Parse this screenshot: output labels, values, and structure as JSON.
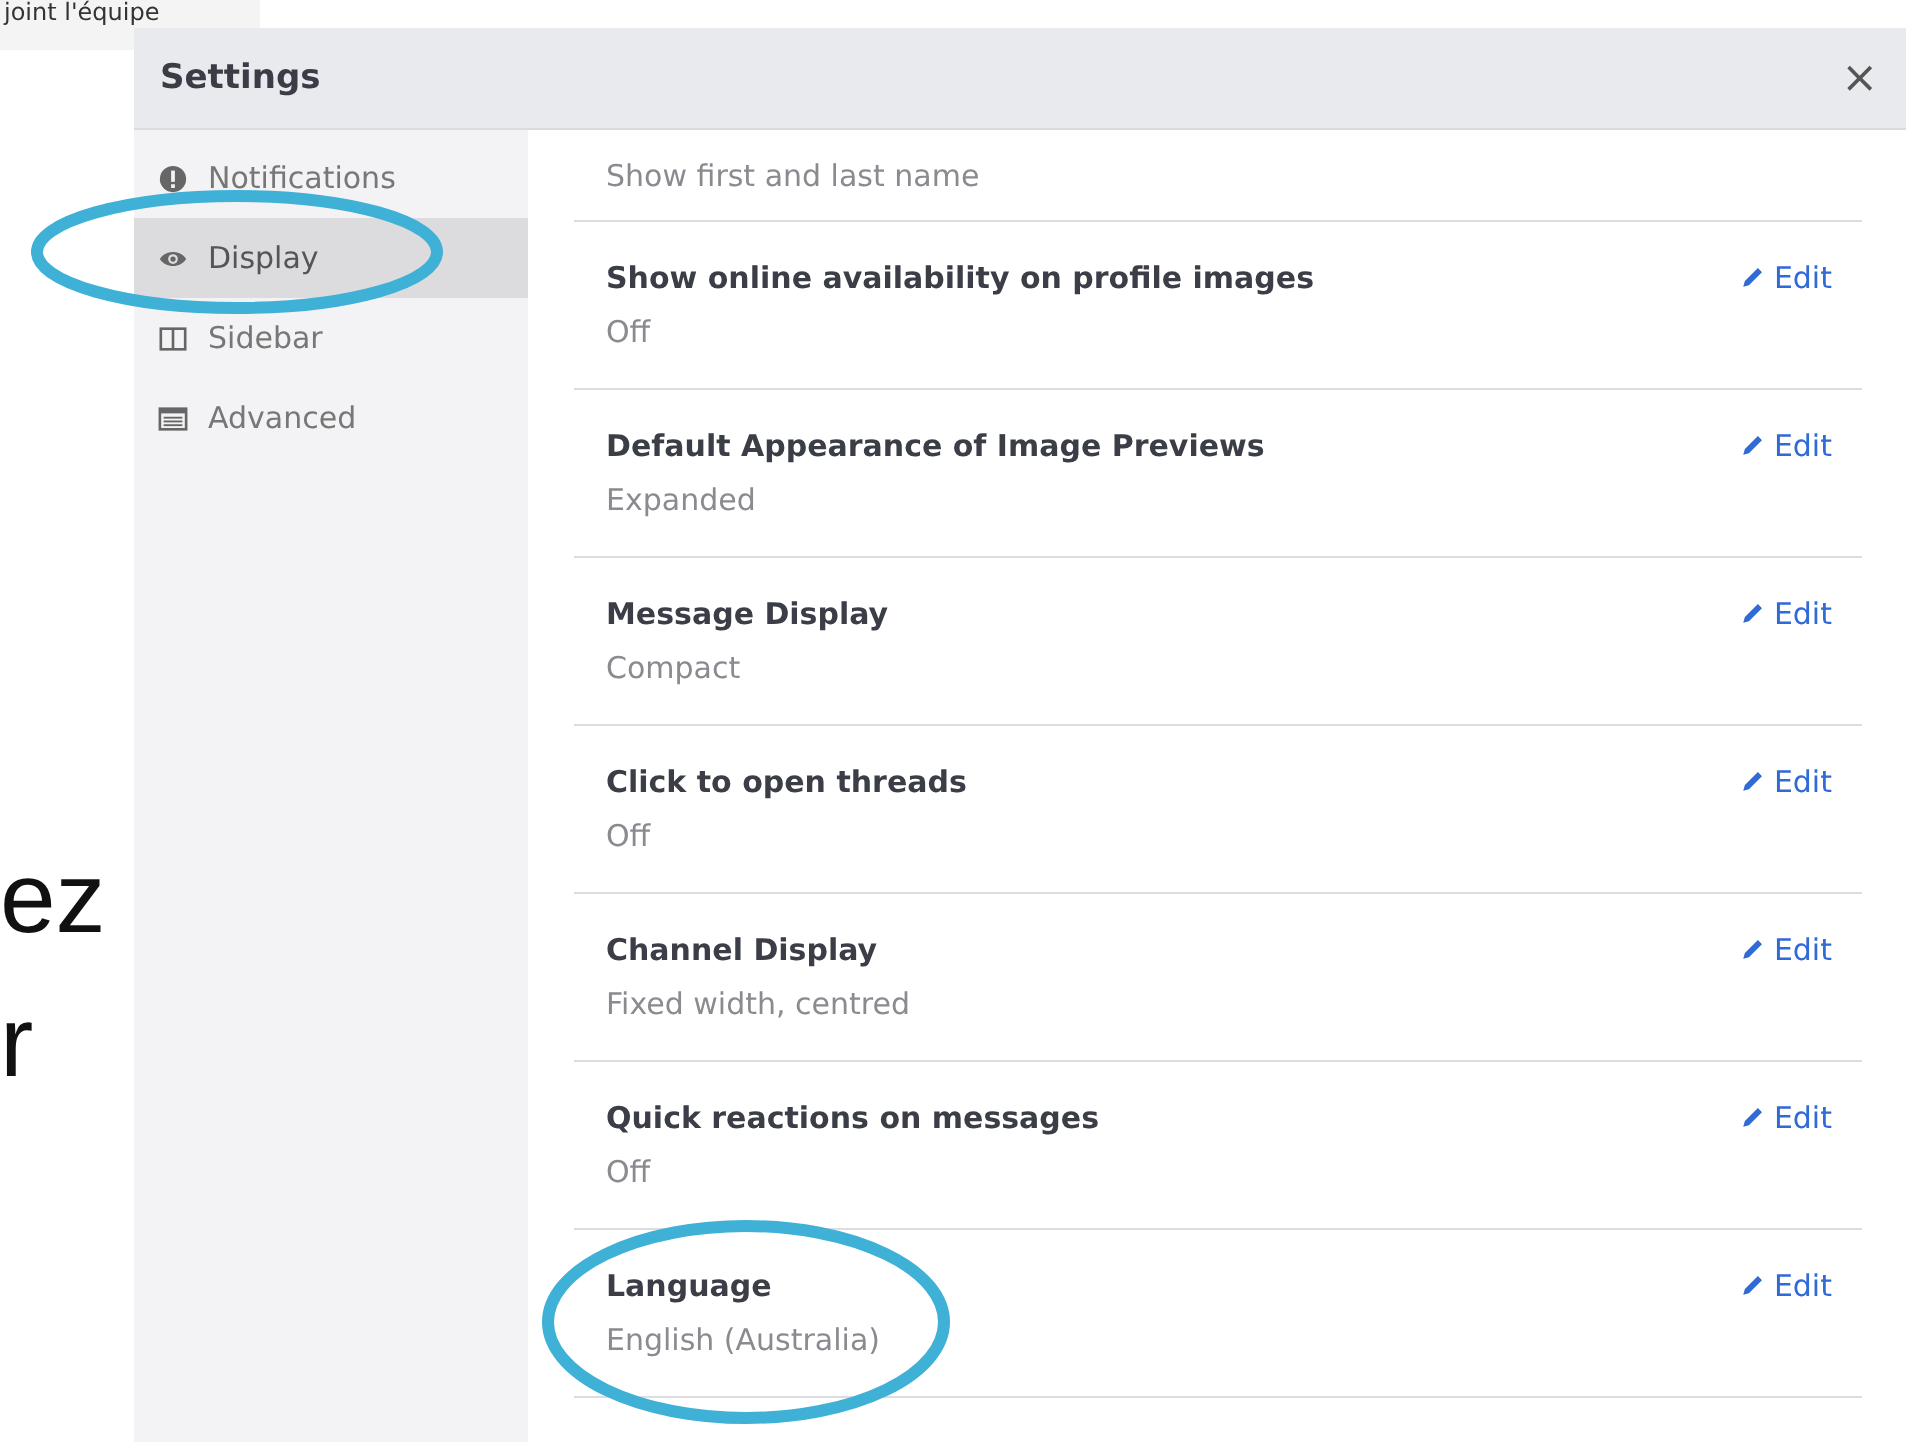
{
  "background_page": {
    "top_tab": "joint l'équipe",
    "text_fragments": [
      "ez",
      "r"
    ]
  },
  "modal": {
    "title": "Settings",
    "close": "×"
  },
  "sidebar": {
    "items": [
      {
        "label": "Notifications",
        "selected": false,
        "circled": false
      },
      {
        "label": "Display",
        "selected": true,
        "circled": true
      },
      {
        "label": "Sidebar",
        "selected": false,
        "circled": false
      },
      {
        "label": "Advanced",
        "selected": false,
        "circled": false
      }
    ]
  },
  "settings": {
    "partial_value": "Show first and last name",
    "rows": [
      {
        "title": "Show online availability on profile images",
        "value": "Off",
        "action": "Edit",
        "circled": false
      },
      {
        "title": "Default Appearance of Image Previews",
        "value": "Expanded",
        "action": "Edit",
        "circled": false
      },
      {
        "title": "Message Display",
        "value": "Compact",
        "action": "Edit",
        "circled": false
      },
      {
        "title": "Click to open threads",
        "value": "Off",
        "action": "Edit",
        "circled": false
      },
      {
        "title": "Channel Display",
        "value": "Fixed width, centred",
        "action": "Edit",
        "circled": false
      },
      {
        "title": "Quick reactions on messages",
        "value": "Off",
        "action": "Edit",
        "circled": false
      },
      {
        "title": "Language",
        "value": "English (Australia)",
        "action": "Edit",
        "circled": true
      }
    ]
  }
}
